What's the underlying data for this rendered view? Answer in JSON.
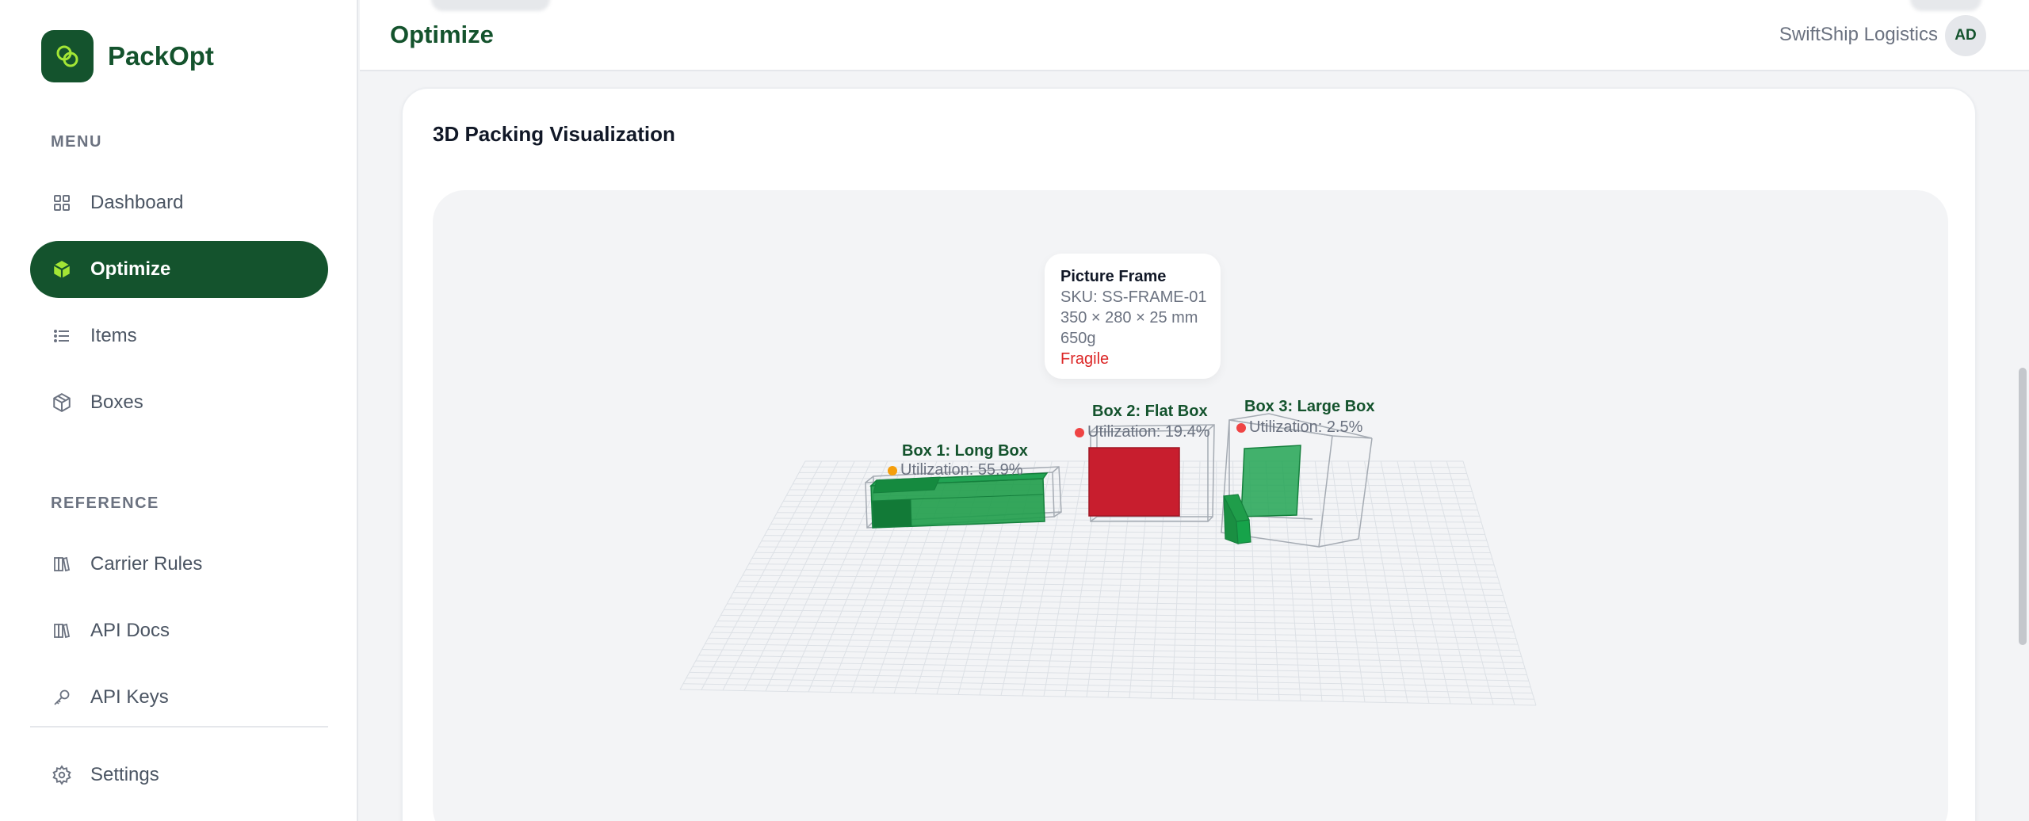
{
  "app": {
    "name": "PackOpt"
  },
  "sidebar": {
    "menu_label": "MENU",
    "reference_label": "REFERENCE",
    "items": [
      {
        "label": "Dashboard",
        "icon": "grid-icon"
      },
      {
        "label": "Optimize",
        "icon": "cube-icon",
        "active": true
      },
      {
        "label": "Items",
        "icon": "list-icon"
      },
      {
        "label": "Boxes",
        "icon": "box-icon"
      }
    ],
    "reference_items": [
      {
        "label": "Carrier Rules",
        "icon": "books-icon"
      },
      {
        "label": "API Docs",
        "icon": "books-icon"
      },
      {
        "label": "API Keys",
        "icon": "key-icon"
      }
    ],
    "settings": {
      "label": "Settings",
      "icon": "gear-icon"
    }
  },
  "header": {
    "title": "Optimize",
    "org": "SwiftShip Logistics",
    "avatar_initials": "AD"
  },
  "card": {
    "title": "3D Packing Visualization"
  },
  "tooltip": {
    "name": "Picture Frame",
    "sku": "SKU: SS-FRAME-01",
    "dimensions": "350 × 280 × 25 mm",
    "weight": "650g",
    "flag": "Fragile"
  },
  "boxes": [
    {
      "label": "Box 1: Long Box",
      "utilization": "Utilization: 55.9%",
      "status_color": "#f59e0b"
    },
    {
      "label": "Box 2: Flat Box",
      "utilization": "Utilization: 19.4%",
      "status_color": "#ef4444"
    },
    {
      "label": "Box 3: Large Box",
      "utilization": "Utilization: 2.5%",
      "status_color": "#ef4444"
    }
  ],
  "colors": {
    "brand": "#14532d",
    "accent": "#a3e635",
    "item_green": "#16a34a",
    "item_red": "#c81e2e",
    "fragile_red": "#dc2626"
  }
}
